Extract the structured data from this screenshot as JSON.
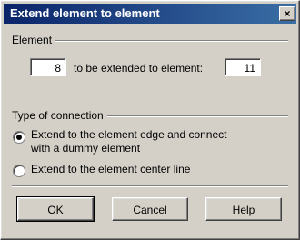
{
  "dialog": {
    "title": "Extend element to element",
    "close_glyph": "×"
  },
  "element_group": {
    "label": "Element",
    "from_value": "8",
    "middle_text": "to be extended to element:",
    "to_value": "11"
  },
  "connection_group": {
    "label": "Type of connection",
    "options": [
      {
        "line1": "Extend to the element edge and connect",
        "line2": "with a dummy element",
        "selected": true
      },
      {
        "line1": "Extend to the element center line",
        "line2": "",
        "selected": false
      }
    ]
  },
  "buttons": {
    "ok": "OK",
    "cancel": "Cancel",
    "help": "Help"
  }
}
